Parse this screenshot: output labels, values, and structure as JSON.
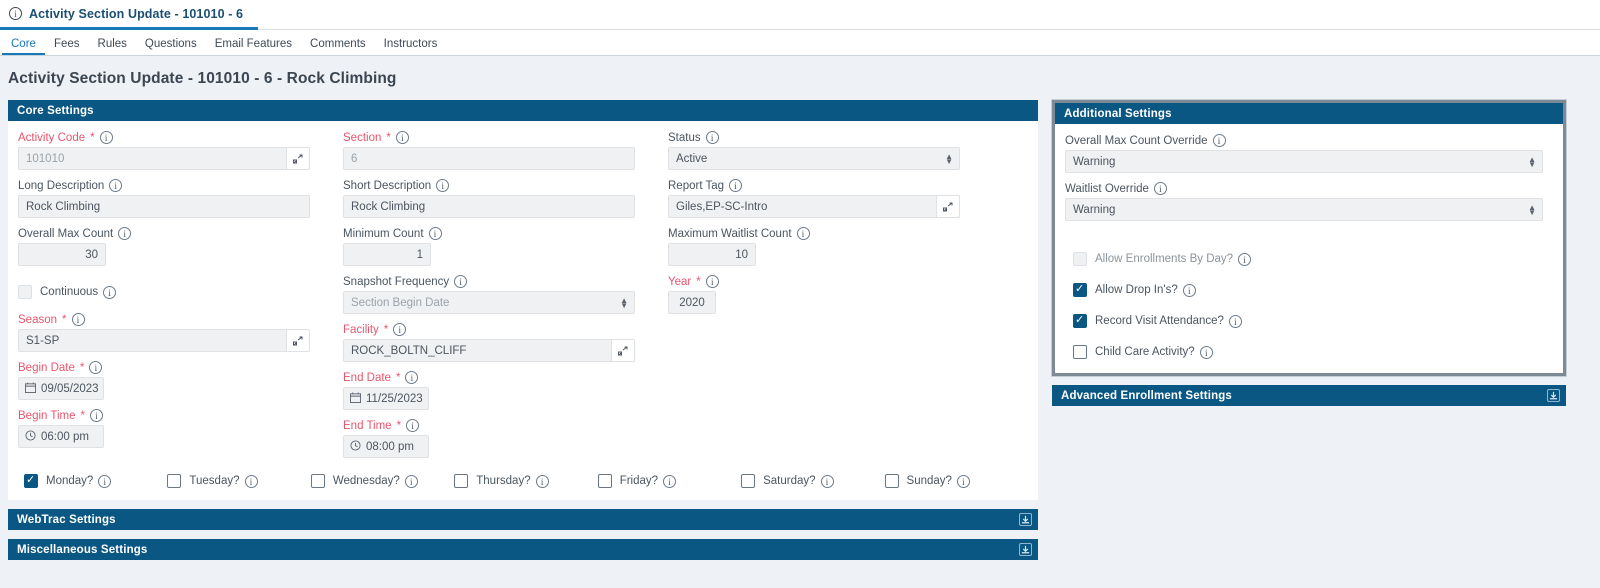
{
  "window": {
    "doc_tab_title": "Activity Section Update - 101010 - 6",
    "doc_tab_icon": "info-circle-icon"
  },
  "nav_tabs": [
    {
      "label": "Core",
      "active": true
    },
    {
      "label": "Fees",
      "active": false
    },
    {
      "label": "Rules",
      "active": false
    },
    {
      "label": "Questions",
      "active": false
    },
    {
      "label": "Email Features",
      "active": false
    },
    {
      "label": "Comments",
      "active": false
    },
    {
      "label": "Instructors",
      "active": false
    }
  ],
  "page_title": "Activity Section Update - 101010 - 6 - Rock Climbing",
  "colors": {
    "panel_header": "#0b5783",
    "accent_link": "#1878b9",
    "required_label": "#e8556f",
    "checkbox_on": "#0b5783",
    "page_background": "#eef1f5",
    "focus_ring": "#7d8a95"
  },
  "core_settings": {
    "header": "Core Settings",
    "column1": {
      "activity_code": {
        "label": "Activity Code",
        "required": true,
        "value": "101010",
        "lookup": true,
        "placeholder": "101010"
      },
      "long_description": {
        "label": "Long Description",
        "required": false,
        "value": "Rock Climbing"
      },
      "overall_max_count": {
        "label": "Overall Max Count",
        "required": false,
        "value": "30"
      },
      "continuous": {
        "label": "Continuous",
        "checked": false,
        "disabled": true
      },
      "season": {
        "label": "Season",
        "required": true,
        "value": "S1-SP",
        "lookup": true
      },
      "begin_date": {
        "label": "Begin Date",
        "required": true,
        "value": "09/05/2023",
        "icon": "calendar-icon"
      },
      "begin_time": {
        "label": "Begin Time",
        "required": true,
        "value": "06:00 pm",
        "icon": "clock-icon"
      }
    },
    "column2": {
      "section": {
        "label": "Section",
        "required": true,
        "value": "6"
      },
      "short_description": {
        "label": "Short Description",
        "required": false,
        "value": "Rock Climbing"
      },
      "minimum_count": {
        "label": "Minimum Count",
        "required": false,
        "value": "1"
      },
      "snapshot_frequency": {
        "label": "Snapshot Frequency",
        "required": false,
        "value": "Section Begin Date",
        "is_placeholder": true
      },
      "facility": {
        "label": "Facility",
        "required": true,
        "value": "ROCK_BOLTN_CLIFF",
        "lookup": true
      },
      "end_date": {
        "label": "End Date",
        "required": true,
        "value": "11/25/2023",
        "icon": "calendar-icon"
      },
      "end_time": {
        "label": "End Time",
        "required": true,
        "value": "08:00 pm",
        "icon": "clock-icon"
      }
    },
    "column3": {
      "status": {
        "label": "Status",
        "required": false,
        "value": "Active"
      },
      "report_tag": {
        "label": "Report Tag",
        "required": false,
        "value": "Giles,EP-SC-Intro",
        "lookup": true
      },
      "maximum_waitlist_count": {
        "label": "Maximum Waitlist Count",
        "required": false,
        "value": "10"
      },
      "year": {
        "label": "Year",
        "required": true,
        "value": "2020"
      }
    },
    "days": [
      {
        "label": "Monday?",
        "checked": true
      },
      {
        "label": "Tuesday?",
        "checked": false
      },
      {
        "label": "Wednesday?",
        "checked": false
      },
      {
        "label": "Thursday?",
        "checked": false
      },
      {
        "label": "Friday?",
        "checked": false
      },
      {
        "label": "Saturday?",
        "checked": false
      },
      {
        "label": "Sunday?",
        "checked": false
      }
    ]
  },
  "additional_settings": {
    "header": "Additional Settings",
    "overall_max_count_override": {
      "label": "Overall Max Count Override",
      "value": "Warning"
    },
    "waitlist_override": {
      "label": "Waitlist Override",
      "value": "Warning"
    },
    "checkboxes": [
      {
        "label": "Allow Enrollments By Day?",
        "checked": false,
        "disabled": true
      },
      {
        "label": "Allow Drop In's?",
        "checked": true,
        "disabled": false
      },
      {
        "label": "Record Visit Attendance?",
        "checked": true,
        "disabled": false
      },
      {
        "label": "Child Care Activity?",
        "checked": false,
        "disabled": false
      }
    ]
  },
  "collapsed_panels": {
    "advanced_enrollment_settings": {
      "header": "Advanced Enrollment Settings",
      "expand_icon": "expand-down-icon"
    },
    "webtrac_settings": {
      "header": "WebTrac Settings",
      "expand_icon": "expand-down-icon"
    },
    "miscellaneous_settings": {
      "header": "Miscellaneous Settings",
      "expand_icon": "expand-down-icon"
    }
  }
}
